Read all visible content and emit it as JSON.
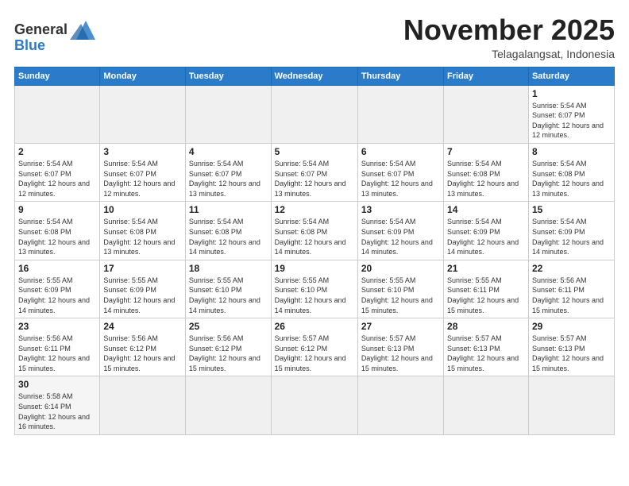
{
  "header": {
    "logo_general": "General",
    "logo_blue": "Blue",
    "month_title": "November 2025",
    "location": "Telagalangsat, Indonesia"
  },
  "days_of_week": [
    "Sunday",
    "Monday",
    "Tuesday",
    "Wednesday",
    "Thursday",
    "Friday",
    "Saturday"
  ],
  "weeks": [
    [
      {
        "day": "",
        "info": "",
        "empty": true
      },
      {
        "day": "",
        "info": "",
        "empty": true
      },
      {
        "day": "",
        "info": "",
        "empty": true
      },
      {
        "day": "",
        "info": "",
        "empty": true
      },
      {
        "day": "",
        "info": "",
        "empty": true
      },
      {
        "day": "",
        "info": "",
        "empty": true
      },
      {
        "day": "1",
        "info": "Sunrise: 5:54 AM\nSunset: 6:07 PM\nDaylight: 12 hours and 12 minutes."
      }
    ],
    [
      {
        "day": "2",
        "info": "Sunrise: 5:54 AM\nSunset: 6:07 PM\nDaylight: 12 hours and 12 minutes."
      },
      {
        "day": "3",
        "info": "Sunrise: 5:54 AM\nSunset: 6:07 PM\nDaylight: 12 hours and 12 minutes."
      },
      {
        "day": "4",
        "info": "Sunrise: 5:54 AM\nSunset: 6:07 PM\nDaylight: 12 hours and 13 minutes."
      },
      {
        "day": "5",
        "info": "Sunrise: 5:54 AM\nSunset: 6:07 PM\nDaylight: 12 hours and 13 minutes."
      },
      {
        "day": "6",
        "info": "Sunrise: 5:54 AM\nSunset: 6:07 PM\nDaylight: 12 hours and 13 minutes."
      },
      {
        "day": "7",
        "info": "Sunrise: 5:54 AM\nSunset: 6:08 PM\nDaylight: 12 hours and 13 minutes."
      },
      {
        "day": "8",
        "info": "Sunrise: 5:54 AM\nSunset: 6:08 PM\nDaylight: 12 hours and 13 minutes."
      }
    ],
    [
      {
        "day": "9",
        "info": "Sunrise: 5:54 AM\nSunset: 6:08 PM\nDaylight: 12 hours and 13 minutes."
      },
      {
        "day": "10",
        "info": "Sunrise: 5:54 AM\nSunset: 6:08 PM\nDaylight: 12 hours and 13 minutes."
      },
      {
        "day": "11",
        "info": "Sunrise: 5:54 AM\nSunset: 6:08 PM\nDaylight: 12 hours and 14 minutes."
      },
      {
        "day": "12",
        "info": "Sunrise: 5:54 AM\nSunset: 6:08 PM\nDaylight: 12 hours and 14 minutes."
      },
      {
        "day": "13",
        "info": "Sunrise: 5:54 AM\nSunset: 6:09 PM\nDaylight: 12 hours and 14 minutes."
      },
      {
        "day": "14",
        "info": "Sunrise: 5:54 AM\nSunset: 6:09 PM\nDaylight: 12 hours and 14 minutes."
      },
      {
        "day": "15",
        "info": "Sunrise: 5:54 AM\nSunset: 6:09 PM\nDaylight: 12 hours and 14 minutes."
      }
    ],
    [
      {
        "day": "16",
        "info": "Sunrise: 5:55 AM\nSunset: 6:09 PM\nDaylight: 12 hours and 14 minutes."
      },
      {
        "day": "17",
        "info": "Sunrise: 5:55 AM\nSunset: 6:09 PM\nDaylight: 12 hours and 14 minutes."
      },
      {
        "day": "18",
        "info": "Sunrise: 5:55 AM\nSunset: 6:10 PM\nDaylight: 12 hours and 14 minutes."
      },
      {
        "day": "19",
        "info": "Sunrise: 5:55 AM\nSunset: 6:10 PM\nDaylight: 12 hours and 14 minutes."
      },
      {
        "day": "20",
        "info": "Sunrise: 5:55 AM\nSunset: 6:10 PM\nDaylight: 12 hours and 15 minutes."
      },
      {
        "day": "21",
        "info": "Sunrise: 5:55 AM\nSunset: 6:11 PM\nDaylight: 12 hours and 15 minutes."
      },
      {
        "day": "22",
        "info": "Sunrise: 5:56 AM\nSunset: 6:11 PM\nDaylight: 12 hours and 15 minutes."
      }
    ],
    [
      {
        "day": "23",
        "info": "Sunrise: 5:56 AM\nSunset: 6:11 PM\nDaylight: 12 hours and 15 minutes."
      },
      {
        "day": "24",
        "info": "Sunrise: 5:56 AM\nSunset: 6:12 PM\nDaylight: 12 hours and 15 minutes."
      },
      {
        "day": "25",
        "info": "Sunrise: 5:56 AM\nSunset: 6:12 PM\nDaylight: 12 hours and 15 minutes."
      },
      {
        "day": "26",
        "info": "Sunrise: 5:57 AM\nSunset: 6:12 PM\nDaylight: 12 hours and 15 minutes."
      },
      {
        "day": "27",
        "info": "Sunrise: 5:57 AM\nSunset: 6:13 PM\nDaylight: 12 hours and 15 minutes."
      },
      {
        "day": "28",
        "info": "Sunrise: 5:57 AM\nSunset: 6:13 PM\nDaylight: 12 hours and 15 minutes."
      },
      {
        "day": "29",
        "info": "Sunrise: 5:57 AM\nSunset: 6:13 PM\nDaylight: 12 hours and 15 minutes."
      }
    ],
    [
      {
        "day": "30",
        "info": "Sunrise: 5:58 AM\nSunset: 6:14 PM\nDaylight: 12 hours and 16 minutes."
      },
      {
        "day": "",
        "info": "",
        "empty": true
      },
      {
        "day": "",
        "info": "",
        "empty": true
      },
      {
        "day": "",
        "info": "",
        "empty": true
      },
      {
        "day": "",
        "info": "",
        "empty": true
      },
      {
        "day": "",
        "info": "",
        "empty": true
      },
      {
        "day": "",
        "info": "",
        "empty": true
      }
    ]
  ]
}
